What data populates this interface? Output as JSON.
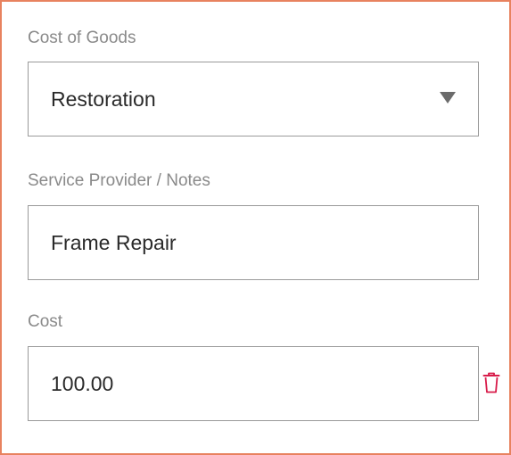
{
  "form": {
    "cost_of_goods": {
      "label": "Cost of Goods",
      "selected_value": "Restoration"
    },
    "service_provider": {
      "label": "Service Provider / Notes",
      "value": "Frame Repair"
    },
    "cost": {
      "label": "Cost",
      "value": "100.00"
    },
    "delete_icon": "trash-icon"
  },
  "colors": {
    "frame_border": "#e8825f",
    "label_text": "#8a8a8a",
    "input_border": "#9a9a9a",
    "value_text": "#2a2a2a",
    "delete_icon": "#d81b4a"
  }
}
